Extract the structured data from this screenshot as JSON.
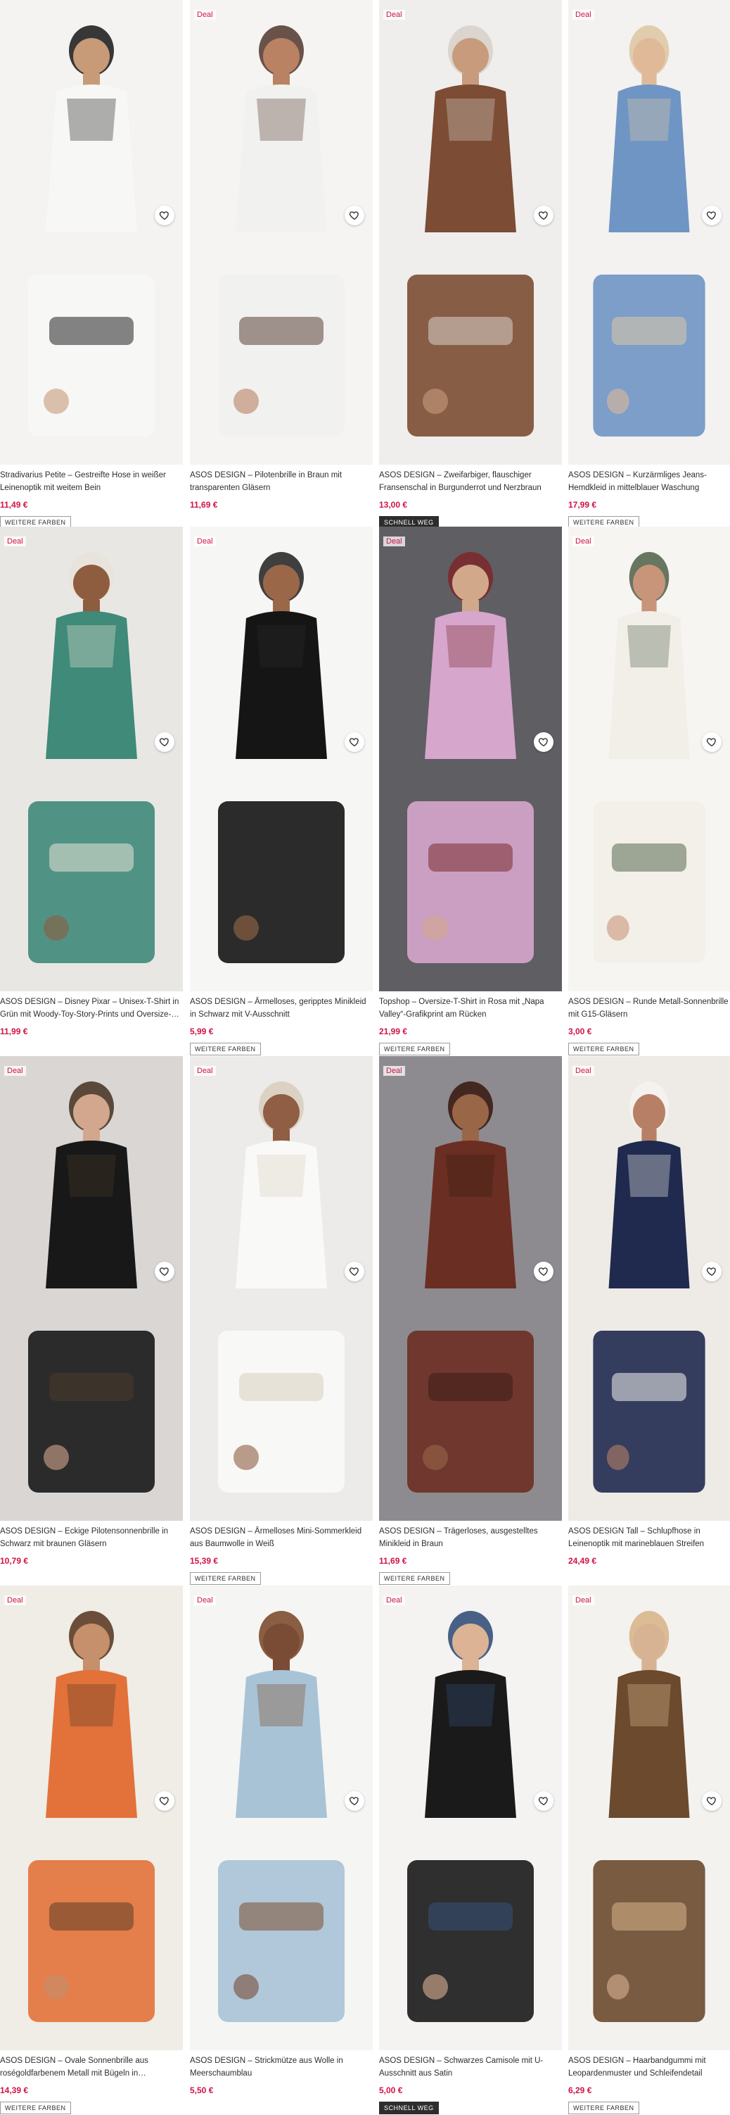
{
  "products": [
    {
      "deal": "",
      "title": "Stradivarius Petite – Gestreifte Hose in weißer Leinenoptik mit weitem Bein",
      "price": "11,49 €",
      "badge": "WEITERE FARBEN",
      "badge_style": "outline",
      "colors": {
        "bg": "#f4f3f1",
        "main": "#f7f7f5",
        "accent": "#222222",
        "skin": "#c79a78"
      }
    },
    {
      "deal": "Deal",
      "title": "ASOS DESIGN – Pilotenbrille in Braun mit transparenten Gläsern",
      "price": "11,69 €",
      "badge": "",
      "badge_style": "",
      "colors": {
        "bg": "#f6f4f2",
        "main": "#f1f1ef",
        "accent": "#5a4036",
        "skin": "#b98262"
      }
    },
    {
      "deal": "Deal",
      "title": "ASOS DESIGN – Zweifarbiger, flauschiger Fransenschal in Burgunderrot und Nerzbraun",
      "price": "13,00 €",
      "badge": "SCHNELL WEG",
      "badge_style": "dark",
      "colors": {
        "bg": "#efeeec",
        "main": "#7c4c34",
        "accent": "#d8d2cb",
        "skin": "#c79b7c"
      }
    },
    {
      "deal": "Deal",
      "title": "ASOS DESIGN – Kurzärmliges Jeans-Hemdkleid in mittelblauer Waschung",
      "price": "17,99 €",
      "badge": "WEITERE FARBEN",
      "badge_style": "outline",
      "colors": {
        "bg": "#f3f2f0",
        "main": "#6f95c4",
        "accent": "#dfc8a5",
        "skin": "#e0b999"
      }
    },
    {
      "deal": "Deal",
      "title": "ASOS DESIGN – Disney Pixar – Unisex-T-Shirt in Grün mit Woody-Toy-Story-Prints und Oversize-…",
      "price": "11,99 €",
      "badge": "",
      "badge_style": "",
      "colors": {
        "bg": "#e9e7e4",
        "main": "#3f8a79",
        "accent": "#e8e3d9",
        "skin": "#8e5c3f"
      }
    },
    {
      "deal": "Deal",
      "title": "ASOS DESIGN – Ärmelloses, geripptes Minikleid in Schwarz mit V-Ausschnitt",
      "price": "5,99 €",
      "badge": "WEITERE FARBEN",
      "badge_style": "outline",
      "colors": {
        "bg": "#f6f6f5",
        "main": "#151515",
        "accent": "#2b2b2b",
        "skin": "#9a6848"
      }
    },
    {
      "deal": "Deal",
      "title": "Topshop – Oversize-T-Shirt in Rosa mit „Napa Valley“-Grafikprint am Rücken",
      "price": "21,99 €",
      "badge": "WEITERE FARBEN",
      "badge_style": "outline",
      "colors": {
        "bg": "#5f5e63",
        "main": "#d6a6cc",
        "accent": "#7a2a2f",
        "skin": "#d2a88a"
      }
    },
    {
      "deal": "Deal",
      "title": "ASOS DESIGN – Runde Metall-Sonnenbrille mit G15-Gläsern",
      "price": "3,00 €",
      "badge": "WEITERE FARBEN",
      "badge_style": "outline",
      "colors": {
        "bg": "#f7f5f2",
        "main": "#f2eee8",
        "accent": "#55684f",
        "skin": "#c9957a"
      }
    },
    {
      "deal": "Deal",
      "title": "ASOS DESIGN – Eckige Pilotensonnenbrille in Schwarz mit braunen Gläsern",
      "price": "10,79 €",
      "badge": "",
      "badge_style": "",
      "colors": {
        "bg": "#d9d6d4",
        "main": "#181818",
        "accent": "#4b3a2a",
        "skin": "#d3a78d"
      }
    },
    {
      "deal": "Deal",
      "title": "ASOS DESIGN – Ärmelloses Mini-Sommerkleid aus Baumwolle in Weiß",
      "price": "15,39 €",
      "badge": "WEITERE FARBEN",
      "badge_style": "outline",
      "colors": {
        "bg": "#ecebe9",
        "main": "#f9f9f7",
        "accent": "#d9cfbf",
        "skin": "#8f5e45"
      }
    },
    {
      "deal": "Deal",
      "title": "ASOS DESIGN – Trägerloses, ausgestelltes Minikleid in Braun",
      "price": "11,69 €",
      "badge": "WEITERE FARBEN",
      "badge_style": "outline",
      "colors": {
        "bg": "#8d8b90",
        "main": "#6b2e22",
        "accent": "#3a1d15",
        "skin": "#9a6648"
      }
    },
    {
      "deal": "Deal",
      "title": "ASOS DESIGN Tall – Schlupfhose in Leinenoptik mit marineblauen Streifen",
      "price": "24,49 €",
      "badge": "",
      "badge_style": "",
      "colors": {
        "bg": "#eeebe6",
        "main": "#1f2a4e",
        "accent": "#f4f2ee",
        "skin": "#b78066"
      }
    },
    {
      "deal": "Deal",
      "title": "ASOS DESIGN – Ovale Sonnenbrille aus roségoldfarbenem Metall mit Bügeln in…",
      "price": "14,39 €",
      "badge": "WEITERE FARBEN",
      "badge_style": "outline",
      "colors": {
        "bg": "#f0ece6",
        "main": "#e2723a",
        "accent": "#5c3d27",
        "skin": "#c5906b"
      }
    },
    {
      "deal": "Deal",
      "title": "ASOS DESIGN – Strickmütze aus Wolle in Meerschaumblau",
      "price": "5,50 €",
      "badge": "",
      "badge_style": "",
      "colors": {
        "bg": "#f5f5f4",
        "main": "#a9c3d6",
        "accent": "#7d4e2f",
        "skin": "#7a4b35"
      }
    },
    {
      "deal": "Deal",
      "title": "ASOS DESIGN – Schwarzes Camisole mit U-Ausschnitt aus Satin",
      "price": "5,00 €",
      "badge": "SCHNELL WEG",
      "badge_style": "dark",
      "colors": {
        "bg": "#f4f3f2",
        "main": "#1a1a1a",
        "accent": "#35507a",
        "skin": "#dcb394"
      }
    },
    {
      "deal": "Deal",
      "title": "ASOS DESIGN – Haarbandgummi mit Leopardenmuster und Schleifendetail",
      "price": "6,29 €",
      "badge": "WEITERE FARBEN",
      "badge_style": "outline",
      "colors": {
        "bg": "#f4f2ef",
        "main": "#6b4a2d",
        "accent": "#d8b68b",
        "skin": "#d8b393"
      }
    }
  ]
}
